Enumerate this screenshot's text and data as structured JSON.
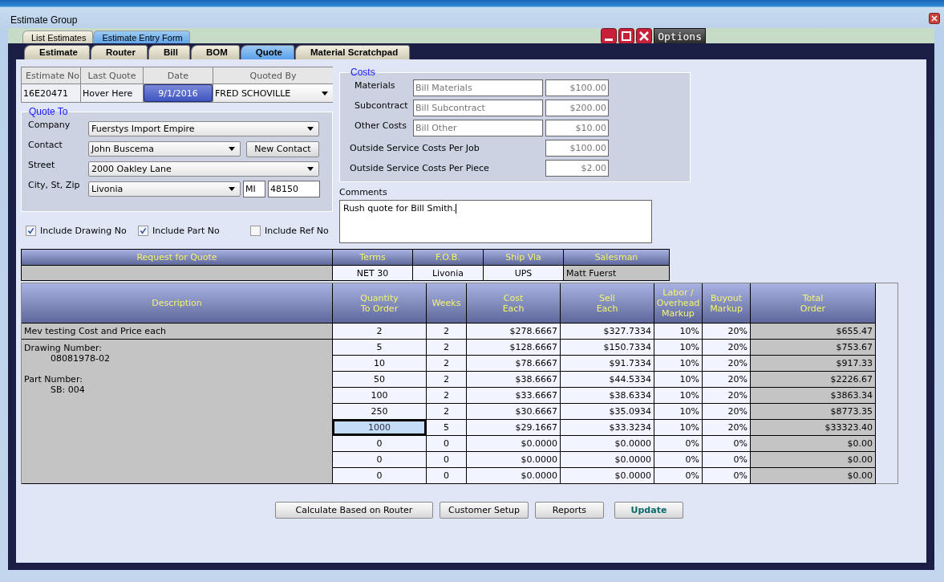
{
  "window": {
    "title": "Estimate Group"
  },
  "outer_tabs": [
    {
      "label": "List Estimates",
      "selected": false
    },
    {
      "label": "Estimate Entry Form",
      "selected": true
    }
  ],
  "options_button": "Options",
  "inner_tabs": [
    {
      "label": "Estimate",
      "selected": false
    },
    {
      "label": "Router",
      "selected": false
    },
    {
      "label": "Bill",
      "selected": false
    },
    {
      "label": "BOM",
      "selected": false
    },
    {
      "label": "Quote",
      "selected": true
    },
    {
      "label": "Material Scratchpad",
      "selected": false
    }
  ],
  "header": {
    "columns": [
      "Estimate No",
      "Last Quote",
      "Date",
      "Quoted By"
    ],
    "estimate_no": "16E20471",
    "last_quote": "Hover Here",
    "date": "9/1/2016",
    "quoted_by": "FRED SCHOVILLE"
  },
  "quote_to": {
    "legend": "Quote To",
    "company": {
      "label": "Company",
      "value": "Fuerstys Import Empire"
    },
    "contact": {
      "label": "Contact",
      "value": "John Buscema"
    },
    "new_contact_button": "New Contact",
    "street": {
      "label": "Street",
      "value": "2000 Oakley Lane"
    },
    "city": {
      "label": "City, St, Zip",
      "value": "Livonia",
      "state": "MI",
      "zip": "48150"
    }
  },
  "checkboxes": [
    {
      "label": "Include Drawing No",
      "checked": true
    },
    {
      "label": "Include Part No",
      "checked": true
    },
    {
      "label": "Include Ref No",
      "checked": false
    }
  ],
  "costs": {
    "legend": "Costs",
    "rows": [
      {
        "label": "Materials",
        "source": "Bill Materials",
        "amount": "$100.00"
      },
      {
        "label": "Subcontract",
        "source": "Bill Subcontract",
        "amount": "$200.00"
      },
      {
        "label": "Other Costs",
        "source": "Bill Other",
        "amount": "$10.00"
      },
      {
        "label": "Outside Service Costs Per Job",
        "amount": "$100.00"
      },
      {
        "label": "Outside Service Costs Per Piece",
        "amount": "$2.00"
      }
    ]
  },
  "comments": {
    "label": "Comments",
    "text": "Rush quote for Bill Smith."
  },
  "rfq_table": {
    "columns": [
      "Request for Quote",
      "Terms",
      "F.O.B.",
      "Ship Via",
      "Salesman"
    ],
    "terms": "NET 30",
    "fob": "Livonia",
    "ship_via": "UPS",
    "salesman": "Matt Fuerst"
  },
  "quote_table": {
    "columns": [
      "Description",
      "Quantity\nTo Order",
      "Weeks",
      "Cost\nEach",
      "Sell\nEach",
      "Labor /\nOverhead\nMarkup",
      "Buyout\nMarkup",
      "Total\nOrder"
    ],
    "description": {
      "title": "Mev testing Cost and Price each",
      "drawing_label": "Drawing Number:",
      "drawing_number": "08081978-02",
      "part_label": "Part Number:",
      "part_number": "SB: 004"
    },
    "rows": [
      {
        "quantity": "2",
        "weeks": "2",
        "cost": "$278.6667",
        "sell": "$327.7334",
        "labor": "10%",
        "buyout": "20%",
        "total": "$655.47",
        "selected": false
      },
      {
        "quantity": "5",
        "weeks": "2",
        "cost": "$128.6667",
        "sell": "$150.7334",
        "labor": "10%",
        "buyout": "20%",
        "total": "$753.67",
        "selected": false
      },
      {
        "quantity": "10",
        "weeks": "2",
        "cost": "$78.6667",
        "sell": "$91.7334",
        "labor": "10%",
        "buyout": "20%",
        "total": "$917.33",
        "selected": false
      },
      {
        "quantity": "50",
        "weeks": "2",
        "cost": "$38.6667",
        "sell": "$44.5334",
        "labor": "10%",
        "buyout": "20%",
        "total": "$2226.67",
        "selected": false
      },
      {
        "quantity": "100",
        "weeks": "2",
        "cost": "$33.6667",
        "sell": "$38.6334",
        "labor": "10%",
        "buyout": "20%",
        "total": "$3863.34",
        "selected": false
      },
      {
        "quantity": "250",
        "weeks": "2",
        "cost": "$30.6667",
        "sell": "$35.0934",
        "labor": "10%",
        "buyout": "20%",
        "total": "$8773.35",
        "selected": false
      },
      {
        "quantity": "1000",
        "weeks": "5",
        "cost": "$29.1667",
        "sell": "$33.3234",
        "labor": "10%",
        "buyout": "20%",
        "total": "$33323.40",
        "selected": true
      },
      {
        "quantity": "0",
        "weeks": "0",
        "cost": "$0.0000",
        "sell": "$0.0000",
        "labor": "0%",
        "buyout": "0%",
        "total": "$0.00",
        "selected": false
      },
      {
        "quantity": "0",
        "weeks": "0",
        "cost": "$0.0000",
        "sell": "$0.0000",
        "labor": "0%",
        "buyout": "0%",
        "total": "$0.00",
        "selected": false
      },
      {
        "quantity": "0",
        "weeks": "0",
        "cost": "$0.0000",
        "sell": "$0.0000",
        "labor": "0%",
        "buyout": "0%",
        "total": "$0.00",
        "selected": false
      }
    ]
  },
  "buttons": [
    {
      "label": "Calculate Based on Router",
      "default": false
    },
    {
      "label": "Customer Setup",
      "default": false
    },
    {
      "label": "Reports",
      "default": false
    },
    {
      "label": "Update",
      "default": true
    }
  ]
}
